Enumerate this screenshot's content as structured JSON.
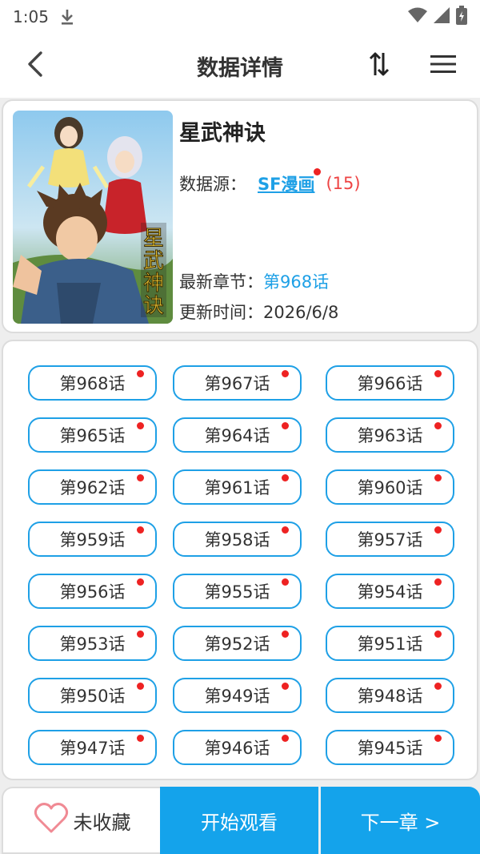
{
  "status_bar": {
    "time": "1:05"
  },
  "header": {
    "title": "数据详情"
  },
  "comic": {
    "title": "星武神诀",
    "source_label": "数据源：",
    "source_name": "SF漫画",
    "source_count": "(15)",
    "latest_label": "最新章节：",
    "latest_chapter": "第968话",
    "update_label": "更新时间：",
    "update_time": "2026/6/8"
  },
  "chapters": [
    {
      "label": "第968话"
    },
    {
      "label": "第967话"
    },
    {
      "label": "第966话"
    },
    {
      "label": "第965话"
    },
    {
      "label": "第964话"
    },
    {
      "label": "第963话"
    },
    {
      "label": "第962话"
    },
    {
      "label": "第961话"
    },
    {
      "label": "第960话"
    },
    {
      "label": "第959话"
    },
    {
      "label": "第958话"
    },
    {
      "label": "第957话"
    },
    {
      "label": "第956话"
    },
    {
      "label": "第955话"
    },
    {
      "label": "第954话"
    },
    {
      "label": "第953话"
    },
    {
      "label": "第952话"
    },
    {
      "label": "第951话"
    },
    {
      "label": "第950话"
    },
    {
      "label": "第949话"
    },
    {
      "label": "第948话"
    },
    {
      "label": "第947话"
    },
    {
      "label": "第946话"
    },
    {
      "label": "第945话"
    }
  ],
  "bottom": {
    "favorite_label": "未收藏",
    "start_label": "开始观看",
    "next_label": "下一章 >"
  },
  "icons": {
    "back": "chevron-left-icon",
    "sort": "sort-arrows-icon",
    "menu": "hamburger-menu-icon",
    "favorite": "heart-outline-icon"
  },
  "colors": {
    "accent": "#14a3eb",
    "link": "#1ea0e6",
    "new_dot": "#ee2222",
    "count": "#e44444"
  }
}
